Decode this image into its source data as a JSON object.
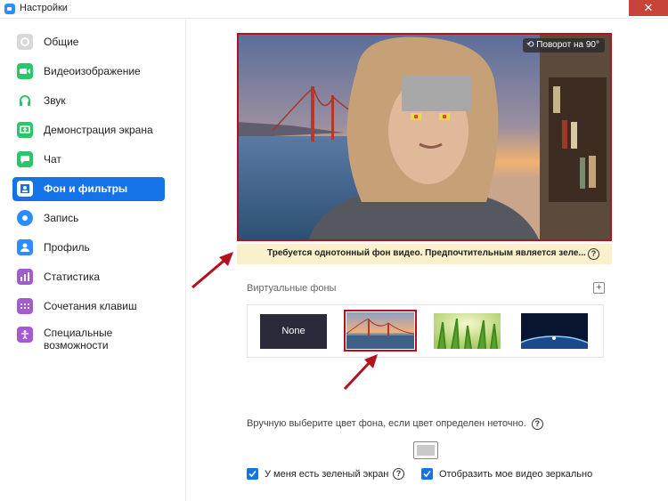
{
  "window": {
    "title": "Настройки",
    "close_glyph": "✕"
  },
  "sidebar": {
    "items": [
      {
        "label": "Общие",
        "icon": "gear-icon",
        "color": "#c9c9c9"
      },
      {
        "label": "Видеоизображение",
        "icon": "video-icon",
        "color": "#2ac769"
      },
      {
        "label": "Звук",
        "icon": "headphones-icon",
        "color": "#2ac769"
      },
      {
        "label": "Демонстрация экрана",
        "icon": "share-screen-icon",
        "color": "#2ac769"
      },
      {
        "label": "Чат",
        "icon": "chat-icon",
        "color": "#2ac769"
      },
      {
        "label": "Фон и фильтры",
        "icon": "background-icon",
        "color": "#ffffff",
        "active": true
      },
      {
        "label": "Запись",
        "icon": "record-icon",
        "color": "#2d8cff"
      },
      {
        "label": "Профиль",
        "icon": "profile-icon",
        "color": "#2d8cff"
      },
      {
        "label": "Статистика",
        "icon": "statistics-icon",
        "color": "#a45bd0"
      },
      {
        "label": "Сочетания клавиш",
        "icon": "keyboard-icon",
        "color": "#a45bd0"
      },
      {
        "label": "Специальные\nвозможности",
        "icon": "accessibility-icon",
        "color": "#a45bd0"
      }
    ]
  },
  "preview": {
    "rotate_label": "Поворот на 90°"
  },
  "notice": {
    "text": "Требуется однотонный фон видео. Предпочтительным является зеле...",
    "help_glyph": "?"
  },
  "virtual_backgrounds": {
    "label": "Виртуальные фоны",
    "add_glyph": "+",
    "thumbnails": [
      {
        "label": "None",
        "kind": "none"
      },
      {
        "label": "",
        "kind": "golden-gate",
        "selected": true
      },
      {
        "label": "",
        "kind": "grass"
      },
      {
        "label": "",
        "kind": "earth-space"
      }
    ]
  },
  "manual_color": {
    "label": "Вручную выберите цвет фона, если цвет определен неточно.",
    "help_glyph": "?"
  },
  "options": {
    "green_screen_label": "У меня есть зеленый экран",
    "green_screen_checked": true,
    "green_screen_help": "?",
    "mirror_label": "Отобразить мое видео зеркально",
    "mirror_checked": true
  },
  "colors": {
    "accent": "#1473e6",
    "highlight_frame": "#b3111d",
    "notice_bg": "#fbf0cc"
  }
}
